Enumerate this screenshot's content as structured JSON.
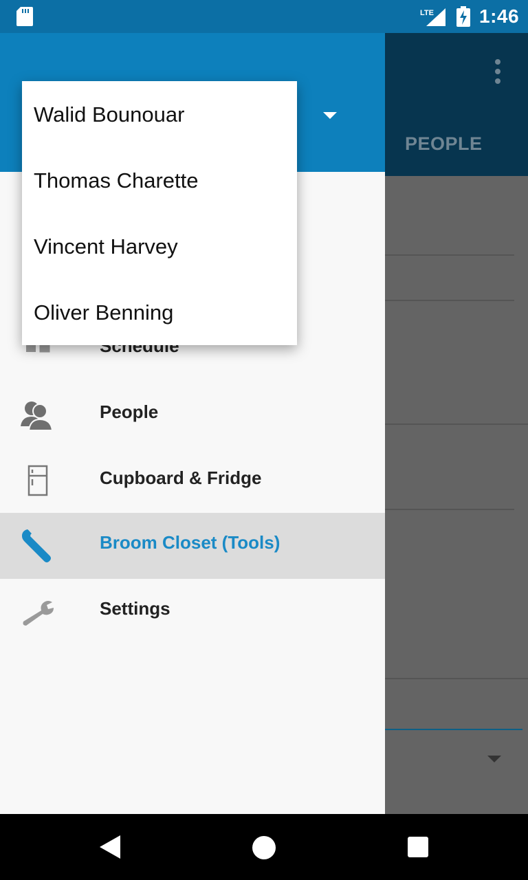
{
  "status_bar": {
    "time": "1:46",
    "network": "LTE",
    "icons": [
      "sd-card-icon",
      "lte-signal-icon",
      "battery-charging-icon"
    ]
  },
  "background": {
    "tab_people": "PEOPLE"
  },
  "account_dropdown": {
    "options": [
      "Walid Bounouar",
      "Thomas Charette",
      "Vincent Harvey",
      "Oliver Benning"
    ]
  },
  "drawer": {
    "items": [
      {
        "label": "Schedule",
        "icon": "schedule-icon"
      },
      {
        "label": "People",
        "icon": "people-icon"
      },
      {
        "label": "Cupboard & Fridge",
        "icon": "fridge-icon"
      },
      {
        "label": "Broom Closet (Tools)",
        "icon": "wrench-icon",
        "selected": true
      },
      {
        "label": "Settings",
        "icon": "settings-wrench-icon"
      }
    ]
  },
  "colors": {
    "primary": "#0d80bc",
    "status_bar": "#0c6fa5",
    "selected_text": "#1a8ac6",
    "selected_bg": "#dcdcdc"
  }
}
